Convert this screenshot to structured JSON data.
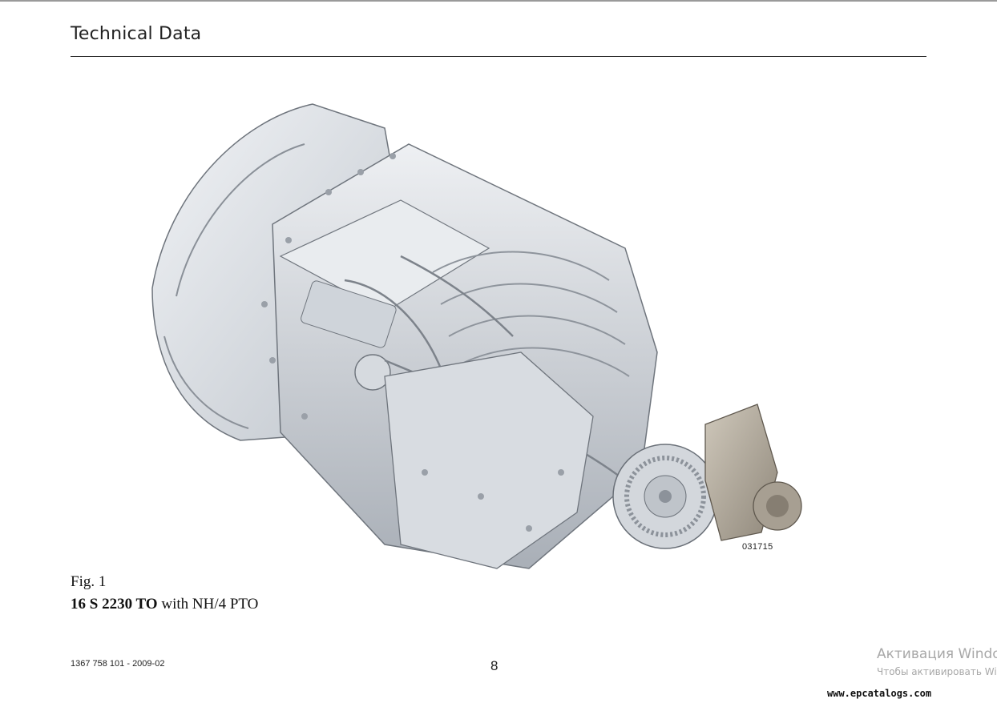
{
  "header": {
    "title": "Technical Data"
  },
  "figure": {
    "image_number": "031715",
    "label": "Fig. 1",
    "model": "16 S 2230 TO",
    "model_suffix": " with NH/4 PTO",
    "subject": "transmission-illustration"
  },
  "footer": {
    "doc_number": "1367 758 101 - 2009-02",
    "page_number": "8"
  },
  "watermarks": {
    "activation_title": "Активация Windows",
    "activation_sub": "Чтобы активировать Windows",
    "site": "www.epcatalogs.com"
  },
  "colors": {
    "housing": "#dfe3e8",
    "housing_shadow": "#aeb4bc",
    "pto": "#b0a89a"
  }
}
